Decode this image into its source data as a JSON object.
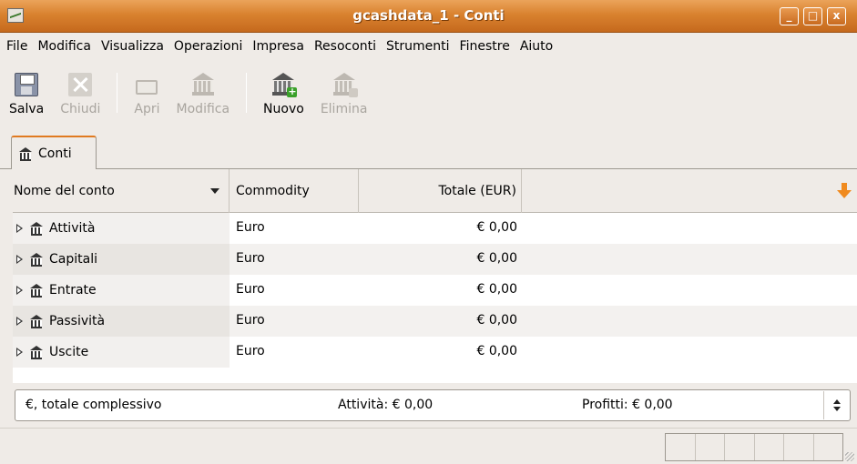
{
  "window": {
    "title": "gcashdata_1 - Conti",
    "controls": [
      "minimize",
      "maximize",
      "close"
    ]
  },
  "menubar": {
    "items": [
      "File",
      "Modifica",
      "Visualizza",
      "Operazioni",
      "Impresa",
      "Resoconti",
      "Strumenti",
      "Finestre",
      "Aiuto"
    ]
  },
  "toolbar": {
    "buttons": [
      {
        "label": "Salva",
        "icon": "save-icon",
        "enabled": true
      },
      {
        "label": "Chiudi",
        "icon": "close-icon",
        "enabled": false
      },
      {
        "label": "Apri",
        "icon": "open-account-icon",
        "enabled": false
      },
      {
        "label": "Modifica",
        "icon": "edit-account-icon",
        "enabled": false
      },
      {
        "label": "Nuovo",
        "icon": "new-account-icon",
        "enabled": true
      },
      {
        "label": "Elimina",
        "icon": "delete-account-icon",
        "enabled": false
      }
    ]
  },
  "tabs": [
    {
      "label": "Conti",
      "icon": "bank-icon",
      "active": true
    }
  ],
  "tree": {
    "columns": [
      "Nome del conto",
      "Commodity",
      "Totale (EUR)"
    ],
    "rows": [
      {
        "name": "Attività",
        "commodity": "Euro",
        "total": "€ 0,00"
      },
      {
        "name": "Capitali",
        "commodity": "Euro",
        "total": "€ 0,00"
      },
      {
        "name": "Entrate",
        "commodity": "Euro",
        "total": "€ 0,00"
      },
      {
        "name": "Passività",
        "commodity": "Euro",
        "total": "€ 0,00"
      },
      {
        "name": "Uscite",
        "commodity": "Euro",
        "total": "€ 0,00"
      }
    ]
  },
  "summary": {
    "label": "€, totale complessivo",
    "assets": "Attività: € 0,00",
    "profits": "Profitti: € 0,00"
  },
  "colors": {
    "titlebar": "#d9822f",
    "accent": "#e07a20",
    "background": "#efebe7"
  }
}
